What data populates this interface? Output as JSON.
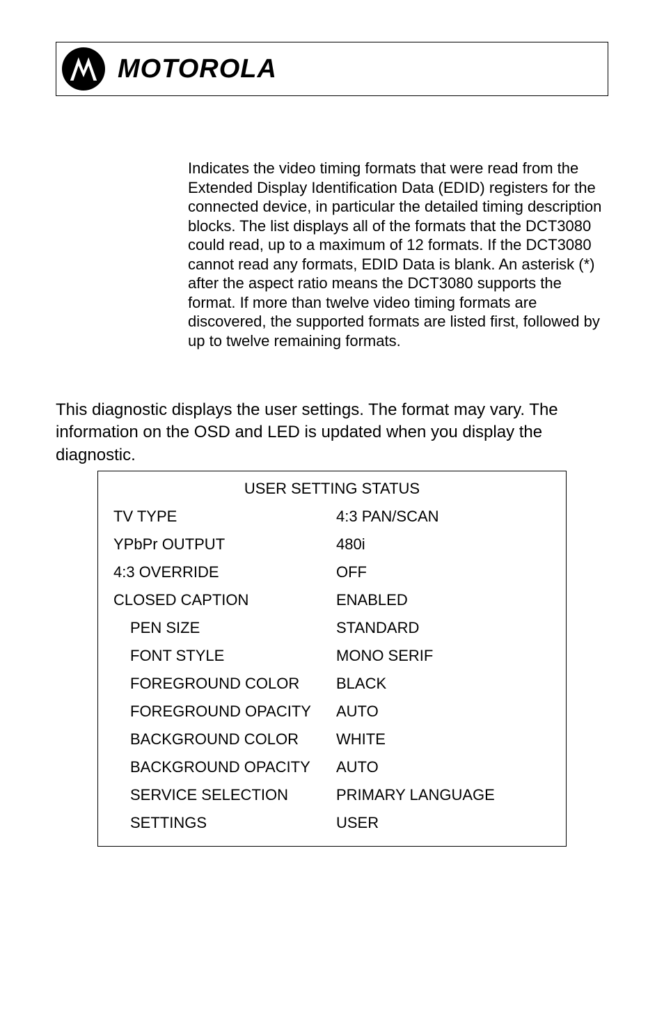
{
  "brand": "MOTOROLA",
  "paragraph": "Indicates the video timing formats that were read from the Extended Display Identification Data (EDID) registers for the connected device, in particular the detailed timing description blocks. The list displays all of the formats that the DCT3080 could read, up to a maximum of 12 formats. If the DCT3080 cannot read any formats, EDID Data is blank. An asterisk (*) after the aspect ratio means the DCT3080 supports the format. If more than twelve video timing formats are discovered, the supported formats       are listed first, followed by up to twelve remaining formats.",
  "intro": "This diagnostic displays the user settings. The format may vary.  The information on the OSD and LED is updated when you display the diagnostic.",
  "table": {
    "title": "USER SETTING STATUS",
    "rows": [
      {
        "label": "TV TYPE",
        "value": "4:3 PAN/SCAN",
        "indent": false
      },
      {
        "label": "YPbPr OUTPUT",
        "value": "480i",
        "indent": false
      },
      {
        "label": "4:3 OVERRIDE",
        "value": "OFF",
        "indent": false
      },
      {
        "label": "CLOSED CAPTION",
        "value": "ENABLED",
        "indent": false
      },
      {
        "label": "PEN SIZE",
        "value": "STANDARD",
        "indent": true
      },
      {
        "label": "FONT STYLE",
        "value": "MONO SERIF",
        "indent": true
      },
      {
        "label": "FOREGROUND COLOR",
        "value": "BLACK",
        "indent": true
      },
      {
        "label": "FOREGROUND OPACITY",
        "value": "AUTO",
        "indent": true
      },
      {
        "label": "BACKGROUND COLOR",
        "value": "WHITE",
        "indent": true
      },
      {
        "label": "BACKGROUND OPACITY",
        "value": "AUTO",
        "indent": true
      },
      {
        "label": "SERVICE SELECTION",
        "value": "PRIMARY LANGUAGE",
        "indent": true
      },
      {
        "label": "SETTINGS",
        "value": "USER",
        "indent": true
      }
    ]
  }
}
